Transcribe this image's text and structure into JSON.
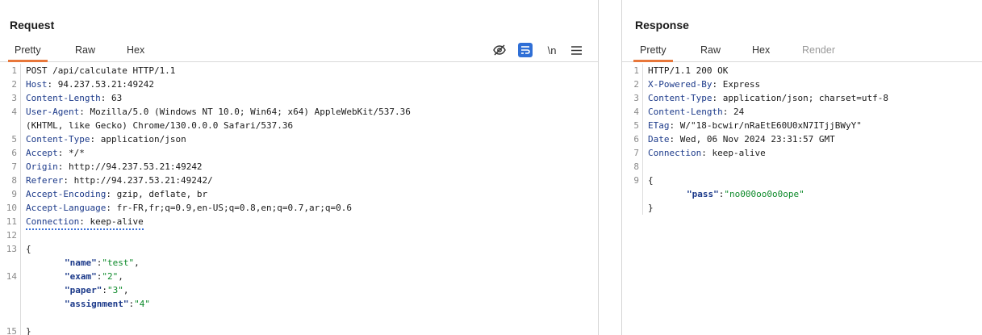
{
  "request": {
    "title": "Request",
    "tabs": [
      "Pretty",
      "Raw",
      "Hex"
    ],
    "active_tab": "Pretty",
    "toolbar": {
      "hide_icon": "eye-slash-icon",
      "wrap_icon": "wrap-lines-icon",
      "newline_label": "\\n",
      "menu_icon": "hamburger-menu-icon"
    },
    "lines": {
      "l1": "POST /api/calculate HTTP/1.1",
      "l2k": "Host",
      "l2v": ": 94.237.53.21:49242",
      "l3k": "Content-Length",
      "l3v": ": 63",
      "l4k": "User-Agent",
      "l4v": ": Mozilla/5.0 (Windows NT 10.0; Win64; x64) AppleWebKit/537.36",
      "l4c": "(KHTML, like Gecko) Chrome/130.0.0.0 Safari/537.36",
      "l5k": "Content-Type",
      "l5v": ": application/json",
      "l6k": "Accept",
      "l6v": ": */*",
      "l7k": "Origin",
      "l7v": ": http://94.237.53.21:49242",
      "l8k": "Referer",
      "l8v": ": http://94.237.53.21:49242/",
      "l9k": "Accept-Encoding",
      "l9v": ": gzip, deflate, br",
      "l10k": "Accept-Language",
      "l10v": ": fr-FR,fr;q=0.9,en-US;q=0.8,en;q=0.7,ar;q=0.6",
      "l11k": "Connection",
      "l11v": ": keep-alive",
      "open": "{",
      "close": "}",
      "name_k": "\"name\"",
      "name_v": "\"test\"",
      "exam_k": "\"exam\"",
      "exam_v": "\"2\"",
      "paper_k": "\"paper\"",
      "paper_v": "\"3\"",
      "assign_k": "\"assignment\"",
      "assign_v": "\"4\""
    }
  },
  "response": {
    "title": "Response",
    "tabs": [
      "Pretty",
      "Raw",
      "Hex",
      "Render"
    ],
    "active_tab": "Pretty",
    "lines": {
      "l1": "HTTP/1.1 200 OK",
      "l2k": "X-Powered-By",
      "l2v": ": Express",
      "l3k": "Content-Type",
      "l3v": ": application/json; charset=utf-8",
      "l4k": "Content-Length",
      "l4v": ": 24",
      "l5k": "ETag",
      "l5v": ": W/\"18-bcwir/nRaEtE60U0xN7ITjjBWyY\"",
      "l6k": "Date",
      "l6v": ": Wed, 06 Nov 2024 23:31:57 GMT",
      "l7k": "Connection",
      "l7v": ": keep-alive",
      "open": "{",
      "close": "}",
      "pass_k": "\"pass\"",
      "pass_v": "\"no000oo0o0ope\""
    }
  },
  "colors": {
    "accent": "#e8773a",
    "header_key": "#1c3a8a",
    "string": "#0d8a2a",
    "wrap_button": "#2f6fd6"
  }
}
